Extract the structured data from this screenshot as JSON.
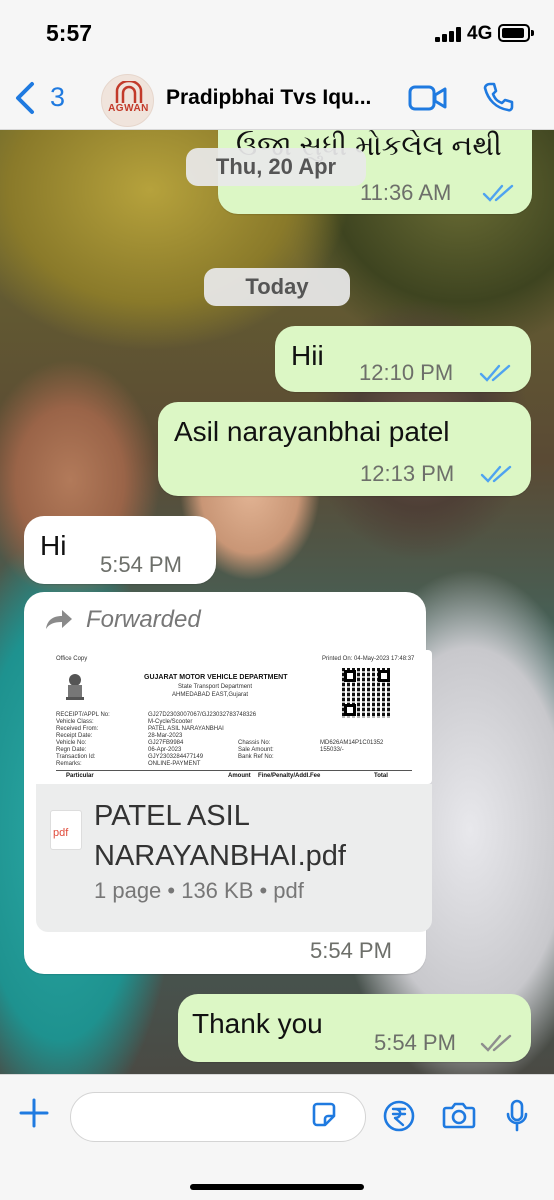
{
  "status_bar": {
    "time": "5:57",
    "network": "4G",
    "battery_level": 0.75
  },
  "header": {
    "back_count": "3",
    "avatar_text": "AGWAN",
    "contact_name": "Pradipbhai Tvs Iqu...",
    "accent_color": "#1f7ae0",
    "icons": [
      "chevron-left-icon",
      "video-call-icon",
      "phone-call-icon"
    ]
  },
  "chat": {
    "partial_message": {
      "text": "ઉજા સુધી મોકલેલ નથી",
      "time": "11:36 AM",
      "status": "read"
    },
    "date_dividers": [
      "Thu, 20 Apr",
      "Today"
    ],
    "messages": [
      {
        "direction": "out",
        "text": "Hii",
        "time": "12:10 PM",
        "status": "read"
      },
      {
        "direction": "out",
        "text": "Asil narayanbhai patel",
        "time": "12:13 PM",
        "status": "read"
      },
      {
        "direction": "in",
        "text": "Hi",
        "time": "5:54 PM"
      },
      {
        "direction": "out",
        "text": "Thank you",
        "time": "5:54 PM",
        "status": "delivered"
      }
    ],
    "document_message": {
      "forwarded_label": "Forwarded",
      "time": "5:54 PM",
      "file_icon": "pdf",
      "file_name": "PATEL ASIL NARAYANBHAI.pdf",
      "file_info": "1 page • 136 KB • pdf",
      "preview": {
        "office_copy": "Office Copy",
        "printed_on": "Printed On: 04-May-2023 17:48:37",
        "department": "GUJARAT MOTOR VEHICLE DEPARTMENT",
        "sub_department": "State Transport Department",
        "office": "AHMEDABAD EAST,Gujarat",
        "rows": [
          [
            "RECEIPT/APPL No:",
            "GJ27D2303007067/GJ23032783748326"
          ],
          [
            "Vehicle Class:",
            "M-Cycle/Scooter"
          ],
          [
            "Received From:",
            "PATEL ASIL NARAYANBHAI"
          ],
          [
            "Receipt Date:",
            "28-Mar-2023"
          ],
          [
            "Vehicle No:",
            "GJ27FB9984"
          ],
          [
            "Regn Date:",
            "06-Apr-2023"
          ],
          [
            "Transaction Id:",
            "GJY2303284477149"
          ],
          [
            "Remarks:",
            "ONLINE-PAYMENT"
          ]
        ],
        "right_rows": [
          [
            "Chassis No:",
            "MD626AM14P1C01352"
          ],
          [
            "Sale Amount:",
            "155033/-"
          ],
          [
            "Bank Ref No:",
            ""
          ]
        ],
        "columns": [
          "Particular",
          "Amount",
          "Fine/Penalty/Addl.Fee",
          "Total"
        ]
      }
    }
  },
  "composer": {
    "icons": [
      "plus-icon",
      "sticker-icon",
      "rupee-payment-icon",
      "camera-icon",
      "microphone-icon"
    ]
  },
  "colors": {
    "outgoing_bubble": "#dcf7c5",
    "incoming_bubble": "#ffffff",
    "read_ticks": "#4fa3f0",
    "delivered_ticks": "#8e8e8e"
  }
}
